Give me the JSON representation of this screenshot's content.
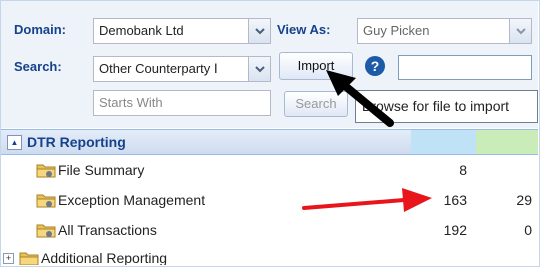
{
  "toolbar": {
    "domain_label": "Domain:",
    "domain_value": "Demobank Ltd",
    "view_as_label": "View As:",
    "view_as_value": "Guy Picken",
    "search_label": "Search:",
    "search_value": "Other Counterparty Ⅰ",
    "starts_with_placeholder": "Starts With",
    "search_button": "Search",
    "import_button": "Import",
    "help_symbol": "?",
    "import_file_field": ""
  },
  "tooltip": {
    "text": "Browse for file to import"
  },
  "panel": {
    "title": "DTR Reporting",
    "collapse_symbol": "▲",
    "column_colors": [
      "#bfe2f7",
      "#c9ecb8"
    ],
    "items": [
      {
        "label": "File Summary",
        "count1": "8",
        "count2": ""
      },
      {
        "label": "Exception Management",
        "count1": "163",
        "count2": "29"
      },
      {
        "label": "All Transactions",
        "count1": "192",
        "count2": "0"
      },
      {
        "label": "Additional Reporting",
        "count1": "",
        "count2": ""
      }
    ],
    "expand_symbol": "+"
  },
  "colors": {
    "label_blue": "#15428b",
    "annotation_red": "#e8151b",
    "annotation_black": "#000000"
  },
  "icons": [
    "chevron-down-icon",
    "help-icon",
    "folder-icon",
    "collapse-icon",
    "expand-icon",
    "annotation-arrow-icon"
  ]
}
